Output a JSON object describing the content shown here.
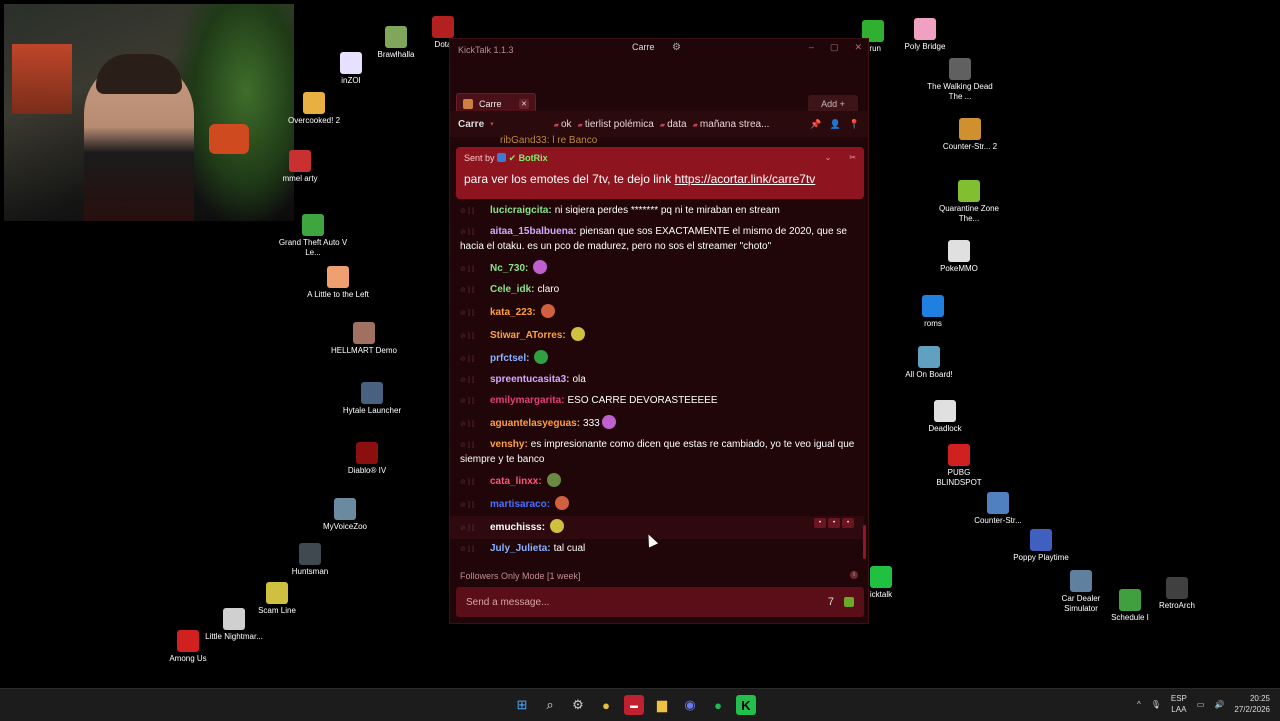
{
  "desktop_icons": [
    {
      "label": "Brawlhalla",
      "color": "#7fa65a"
    },
    {
      "label": "Dota",
      "color": "#b32020"
    },
    {
      "label": "inZOI",
      "color": "#e8e0ff"
    },
    {
      "label": "Overcooked! 2",
      "color": "#e8b040"
    },
    {
      "label": "mmel arty",
      "color": "#c93030"
    },
    {
      "label": "Grand Theft Auto V Le...",
      "color": "#3fa53f"
    },
    {
      "label": "A Little to the Left",
      "color": "#f0a070"
    },
    {
      "label": "HELLMART Demo",
      "color": "#a07060"
    },
    {
      "label": "Hytale Launcher",
      "color": "#4a6080"
    },
    {
      "label": "Diablo® IV",
      "color": "#8a1010"
    },
    {
      "label": "MyVoiceZoo",
      "color": "#6a8aa0"
    },
    {
      "label": "Huntsman",
      "color": "#404850"
    },
    {
      "label": "Scam Line",
      "color": "#d0c040"
    },
    {
      "label": "Little Nightmar...",
      "color": "#d0d0d0"
    },
    {
      "label": "Among Us",
      "color": "#d02020"
    },
    {
      "label": "drun",
      "color": "#30b030"
    },
    {
      "label": "Poly Bridge",
      "color": "#f0a0c0"
    },
    {
      "label": "The Walking Dead The ...",
      "color": "#606060"
    },
    {
      "label": "Counter-Str... 2",
      "color": "#d09030"
    },
    {
      "label": "Quarantine Zone The...",
      "color": "#80c030"
    },
    {
      "label": "PokeMMO",
      "color": "#e0e0e0"
    },
    {
      "label": "roms",
      "color": "#2080e0"
    },
    {
      "label": "All On Board!",
      "color": "#60a0c0"
    },
    {
      "label": "Deadlock",
      "color": "#e0e0e0"
    },
    {
      "label": "PUBG BLINDSPOT",
      "color": "#d02020"
    },
    {
      "label": "Counter-Str...",
      "color": "#5080c0"
    },
    {
      "label": "Poppy Playtime",
      "color": "#4060c0"
    },
    {
      "label": "Car Dealer Simulator",
      "color": "#6080a0"
    },
    {
      "label": "Schedule I",
      "color": "#40a040"
    },
    {
      "label": "RetroArch",
      "color": "#404040"
    },
    {
      "label": "icktalk",
      "color": "#20c040"
    }
  ],
  "window": {
    "title": "KickTalk 1.1.3",
    "channel": "Carre",
    "tab_label": "Carre",
    "add_label": "Add",
    "pinbar_channel": "Carre",
    "pin_tags": [
      "ok",
      "tierlist polémica",
      "data",
      "mañana strea..."
    ],
    "cut_off_line": "ribGand33: l re Banco",
    "pinned": {
      "sent_by": "Sent by",
      "sender": "BotRix",
      "message": "para ver los emotes del 7tv, te dejo link",
      "link": "https://acortar.link/carre7tv"
    },
    "followers_mode": "Followers Only Mode [1 week]",
    "input_placeholder": "Send a message..."
  },
  "messages": [
    {
      "user": "lucicraigcita:",
      "color": "#8be28b",
      "text": "ni siqiera perdes ******* pq ni te miraban en stream"
    },
    {
      "user": "aitaa_15balbuena:",
      "color": "#d5a8ff",
      "text": "piensan que sos EXACTAMENTE el mismo de 2020, que se hacia el otaku. es un pco de madurez, pero no sos el streamer \"choto\""
    },
    {
      "user": "Nc_730:",
      "color": "#8be28b",
      "text": ""
    },
    {
      "user": "Cele_idk:",
      "color": "#8be28b",
      "text": "claro"
    },
    {
      "user": "kata_223:",
      "color": "#ffa040",
      "text": ""
    },
    {
      "user": "Stiwar_ATorres:",
      "color": "#ffa040",
      "text": ""
    },
    {
      "user": "prfctsel:",
      "color": "#8ab0ff",
      "text": ""
    },
    {
      "user": "spreentucasita3:",
      "color": "#d5a8ff",
      "text": "ola"
    },
    {
      "user": "emilymargarita:",
      "color": "#e0407a",
      "text": "ESO CARRE DEVORASTEEEEE"
    },
    {
      "user": "aguantelasyeguas:",
      "color": "#ffa040",
      "text": "333"
    },
    {
      "user": "venshy:",
      "color": "#ffa040",
      "text": "es impresionante como dicen que estas re cambiado, yo te veo igual que siempre y te banco"
    },
    {
      "user": "cata_linxx:",
      "color": "#ff5577",
      "text": ""
    },
    {
      "user": "martisaraco:",
      "color": "#4a70ff",
      "text": ""
    },
    {
      "user": "emuchisss:",
      "color": "#ffffff",
      "text": ""
    },
    {
      "user": "July_Julieta:",
      "color": "#8ab0ff",
      "text": "tal cual"
    }
  ],
  "taskbar": {
    "lang_top": "ESP",
    "lang_bottom": "LAA",
    "time": "20:25",
    "date": "27/2/2026"
  }
}
